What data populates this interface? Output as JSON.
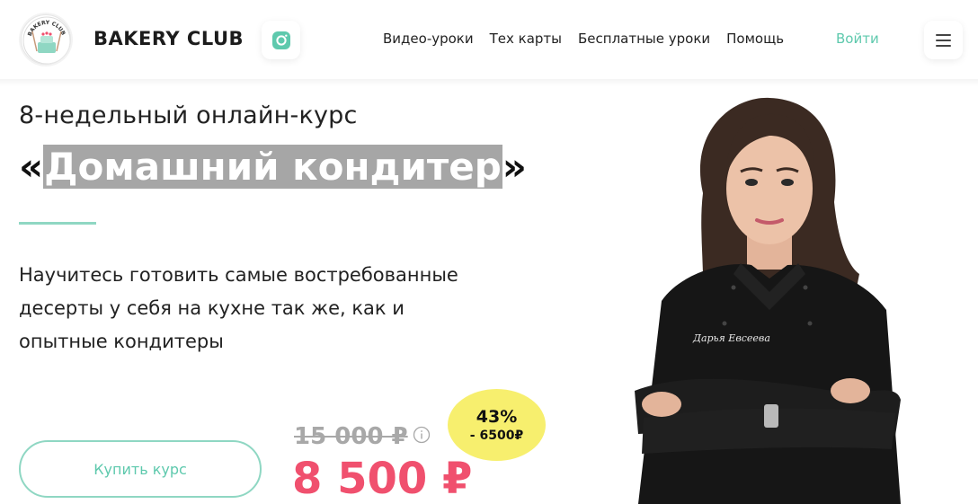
{
  "header": {
    "brand": "BAKERY CLUB",
    "logo_text": "BAKERY CLUB",
    "nav": [
      "Видео-уроки",
      "Тех карты",
      "Бесплатные уроки",
      "Помощь"
    ],
    "login": "Войти",
    "icons": [
      "logo-icon",
      "instagram-icon",
      "hamburger-menu-icon"
    ]
  },
  "hero": {
    "subtitle": "8-недельный онлайн-курс",
    "title_open": "«",
    "title_main": "Домашний кондитер",
    "title_close": "»",
    "description": "Научитесь готовить самые востребованные десерты у себя на кухне так же, как и опытные кондитеры",
    "buy_label": "Купить курс",
    "old_price": "15 000 ₽",
    "new_price": "8 500 ₽",
    "discount_percent": "43%",
    "discount_amount": "- 6500₽",
    "jacket_text": "Дарья Евсеева"
  },
  "colors": {
    "accent": "#5ec9ad",
    "price": "#f0506e",
    "badge": "#f7ef6e",
    "highlight": "#a6a6a6"
  }
}
